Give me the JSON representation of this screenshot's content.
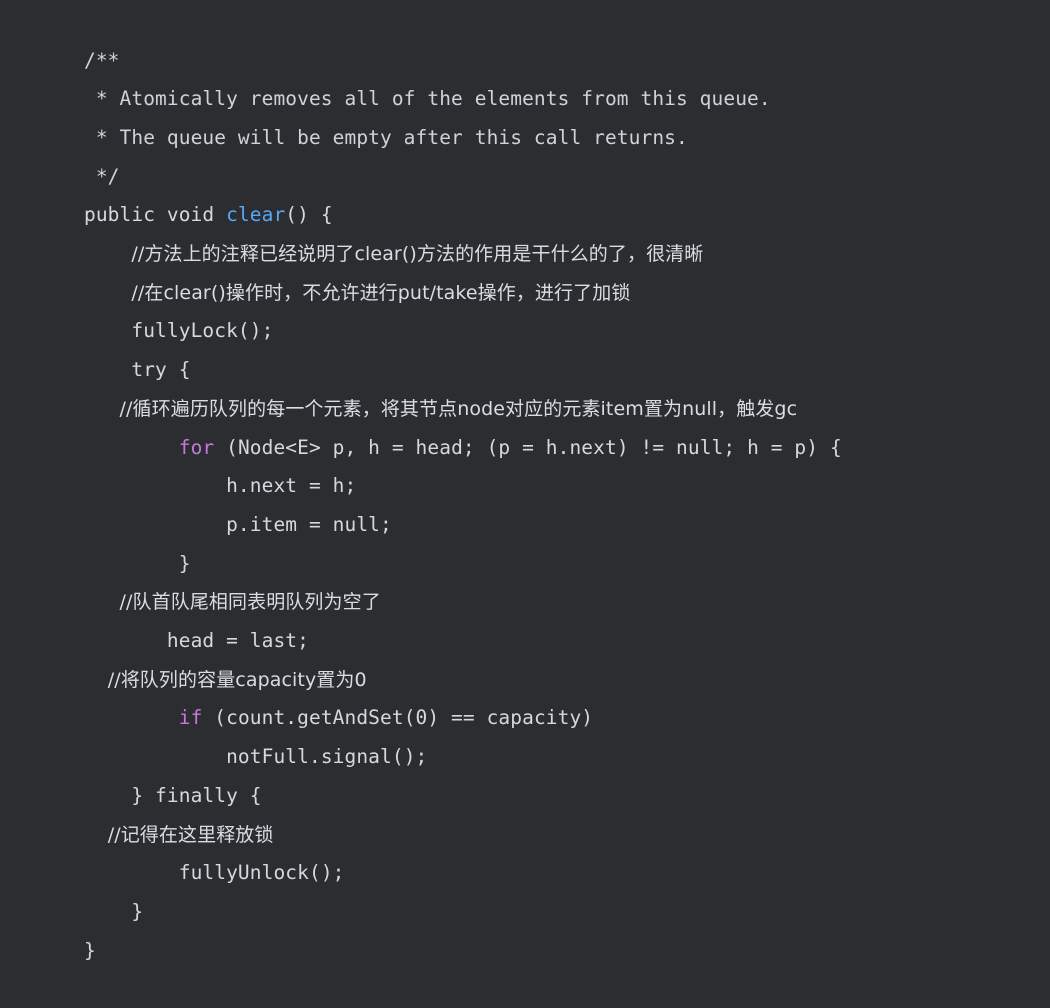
{
  "editor": {
    "background_color": "#2b2d31",
    "default_text_color": "#d5d8dc",
    "keyword_color": "#c778dd",
    "method_color": "#56a8f5",
    "comment_color": "#cfd3d8",
    "language": "java"
  },
  "code": {
    "lines": [
      {
        "id": "line-1",
        "indent": "",
        "tokens": [
          {
            "text": "/**",
            "type": "comment"
          }
        ]
      },
      {
        "id": "line-2",
        "indent": " ",
        "tokens": [
          {
            "text": "* Atomically removes all of the elements from this queue.",
            "type": "comment"
          }
        ]
      },
      {
        "id": "line-3",
        "indent": " ",
        "tokens": [
          {
            "text": "* The queue will be empty after this call returns.",
            "type": "comment"
          }
        ]
      },
      {
        "id": "line-4",
        "indent": " ",
        "tokens": [
          {
            "text": "*/",
            "type": "comment"
          }
        ]
      },
      {
        "id": "line-5",
        "indent": "",
        "tokens": [
          {
            "text": "public void ",
            "type": "default"
          },
          {
            "text": "clear",
            "type": "method"
          },
          {
            "text": "() {",
            "type": "default"
          }
        ]
      },
      {
        "id": "line-6",
        "indent": "    ",
        "tokens": [
          {
            "text": "//方法上的注释已经说明了clear()方法的作用是干什么的了，很清晰",
            "type": "cjk-comment"
          }
        ]
      },
      {
        "id": "line-7",
        "indent": "    ",
        "tokens": [
          {
            "text": "//在clear()操作时，不允许进行put/take操作，进行了加锁",
            "type": "cjk-comment"
          }
        ]
      },
      {
        "id": "line-8",
        "indent": "    ",
        "tokens": [
          {
            "text": "fullyLock();",
            "type": "default"
          }
        ]
      },
      {
        "id": "line-9",
        "indent": "    ",
        "tokens": [
          {
            "text": "try {",
            "type": "default"
          }
        ]
      },
      {
        "id": "line-10",
        "indent": "   ",
        "tokens": [
          {
            "text": "//循环遍历队列的每一个元素，将其节点node对应的元素item置为null，触发gc",
            "type": "cjk-comment"
          }
        ]
      },
      {
        "id": "line-11",
        "indent": "        ",
        "tokens": [
          {
            "text": "for",
            "type": "keyword"
          },
          {
            "text": " (Node<E> p, h = head; (p = h.next) != null; h = p) {",
            "type": "default"
          }
        ]
      },
      {
        "id": "line-12",
        "indent": "            ",
        "tokens": [
          {
            "text": "h.next = h;",
            "type": "default"
          }
        ]
      },
      {
        "id": "line-13",
        "indent": "            ",
        "tokens": [
          {
            "text": "p.item = null;",
            "type": "default"
          }
        ]
      },
      {
        "id": "line-14",
        "indent": "        ",
        "tokens": [
          {
            "text": "}",
            "type": "default"
          }
        ]
      },
      {
        "id": "line-15",
        "indent": "   ",
        "tokens": [
          {
            "text": "//队首队尾相同表明队列为空了",
            "type": "cjk-comment"
          }
        ]
      },
      {
        "id": "line-16",
        "indent": "       ",
        "tokens": [
          {
            "text": "head = last;",
            "type": "default"
          }
        ]
      },
      {
        "id": "line-17",
        "indent": "  ",
        "tokens": [
          {
            "text": "//将队列的容量capacity置为0",
            "type": "cjk-comment"
          }
        ]
      },
      {
        "id": "line-18",
        "indent": "        ",
        "tokens": [
          {
            "text": "if",
            "type": "keyword"
          },
          {
            "text": " (count.getAndSet(0) == capacity)",
            "type": "default"
          }
        ]
      },
      {
        "id": "line-19",
        "indent": "            ",
        "tokens": [
          {
            "text": "notFull.signal();",
            "type": "default"
          }
        ]
      },
      {
        "id": "line-20",
        "indent": "    ",
        "tokens": [
          {
            "text": "} finally {",
            "type": "default"
          }
        ]
      },
      {
        "id": "line-21",
        "indent": "  ",
        "tokens": [
          {
            "text": "//记得在这里释放锁",
            "type": "cjk-comment"
          }
        ]
      },
      {
        "id": "line-22",
        "indent": "        ",
        "tokens": [
          {
            "text": "fullyUnlock();",
            "type": "default"
          }
        ]
      },
      {
        "id": "line-23",
        "indent": "    ",
        "tokens": [
          {
            "text": "}",
            "type": "default"
          }
        ]
      },
      {
        "id": "line-24",
        "indent": "",
        "tokens": [
          {
            "text": "}",
            "type": "default"
          }
        ]
      }
    ]
  }
}
